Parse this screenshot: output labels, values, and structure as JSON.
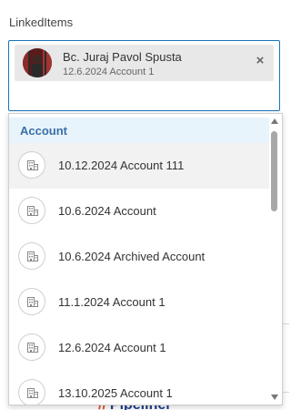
{
  "field": {
    "label": "LinkedItems"
  },
  "selected_chip": {
    "title": "Bc. Juraj Pavol Spusta",
    "subtitle": "12.6.2024 Account 1",
    "avatar_icon": "person-photo-avatar",
    "remove_icon": "close-icon",
    "remove_glyph": "×"
  },
  "dropdown": {
    "group_header": "Account",
    "item_icon": "building-icon",
    "items": [
      {
        "label": "10.12.2024 Account 111",
        "hovered": true
      },
      {
        "label": "10.6.2024 Account"
      },
      {
        "label": "10.6.2024 Archived Account"
      },
      {
        "label": "11.1.2024 Account 1"
      },
      {
        "label": "12.6.2024 Account 1"
      },
      {
        "label": "13.10.2025 Account 1"
      }
    ]
  },
  "background": {
    "logo_text": "Pipeliner"
  },
  "colors": {
    "focus_border": "#1a73b8",
    "group_header_bg": "#e8f4fb",
    "group_header_text": "#3a6fa8",
    "hover_bg": "#f2f2f2"
  }
}
